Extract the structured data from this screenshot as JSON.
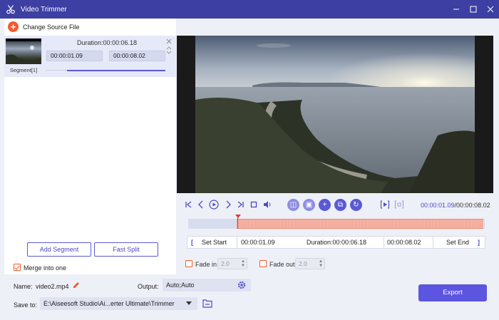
{
  "window": {
    "title": "Video Trimmer",
    "icon": "scissors-icon"
  },
  "left": {
    "change_source": "Change Source File",
    "segment": {
      "duration": "Duration:00:00:06.18",
      "start": "00:00:01.09",
      "end": "00:00:08.02",
      "label": "Segment[1]"
    },
    "add_segment": "Add Segment",
    "fast_split": "Fast Split",
    "merge": {
      "label": "Merge into one",
      "checked": true
    }
  },
  "player": {
    "current_time": "00:00:01.09",
    "total_time": "/00:00:08.02",
    "selection_fraction": [
      0.165,
      0.995
    ],
    "playhead_fraction": 0.165
  },
  "trim": {
    "set_start": "Set Start",
    "start": "00:00:01.09",
    "duration": "Duration:00:00:06.18",
    "end": "00:00:08.02",
    "set_end": "Set End",
    "fade_in_label": "Fade in",
    "fade_in_value": "2.0",
    "fade_out_label": "Fade out",
    "fade_out_value": "2.0"
  },
  "bottom": {
    "name_label": "Name:",
    "name_value": "video2.mp4",
    "output_label": "Output:",
    "output_value": "Auto;Auto",
    "save_label": "Save to:",
    "save_value": "E:\\Aiseesoft Studio\\Ai...erter Ultimate\\Trimmer",
    "export": "Export"
  },
  "colors": {
    "accent": "#5b55e0",
    "titlebar": "#3d3fa3",
    "orange": "#f25b2e"
  }
}
